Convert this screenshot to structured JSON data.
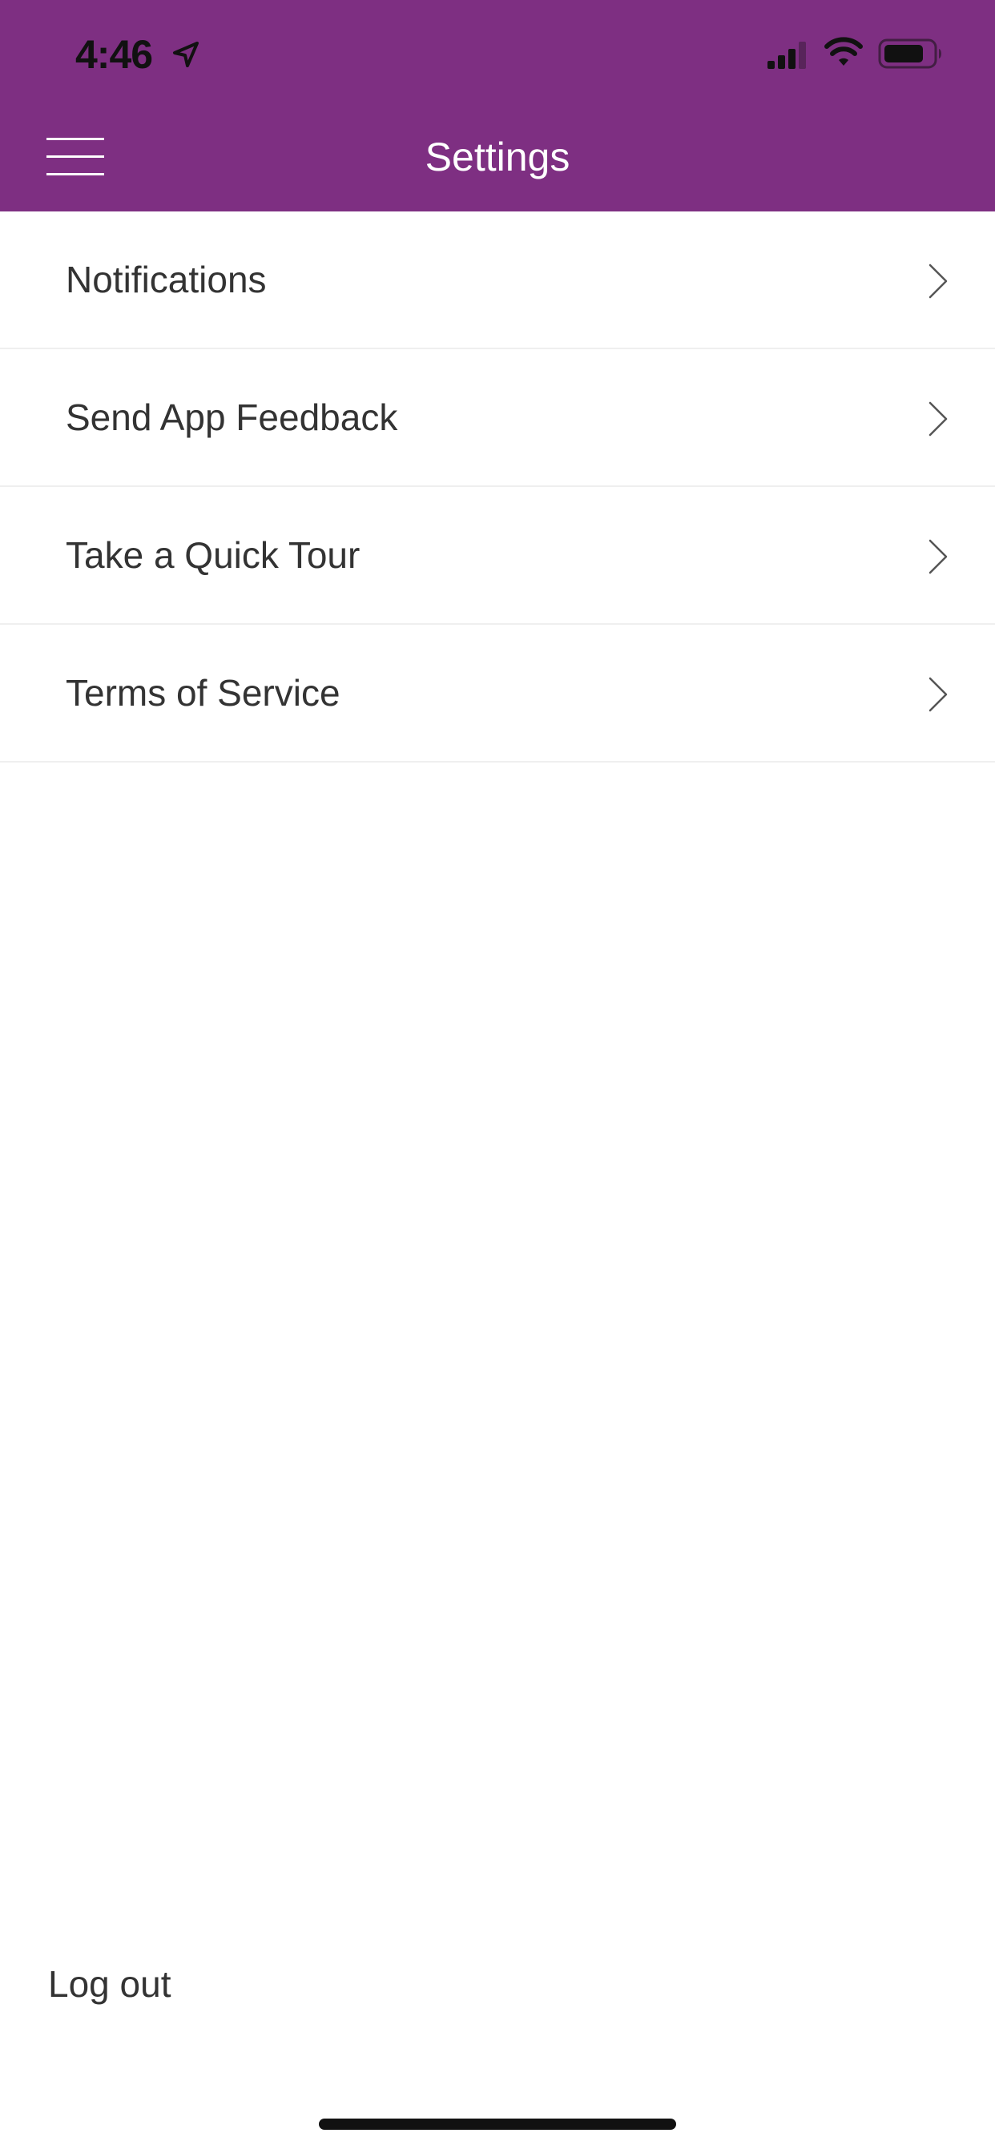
{
  "status_bar": {
    "time": "4:46",
    "icons": [
      "location-arrow-icon",
      "signal-icon",
      "wifi-icon",
      "battery-icon"
    ]
  },
  "header": {
    "title": "Settings",
    "menu_icon": "hamburger-menu-icon",
    "background_color": "#7e2f82"
  },
  "settings": {
    "items": [
      {
        "label": "Notifications"
      },
      {
        "label": "Send App Feedback"
      },
      {
        "label": "Take a Quick Tour"
      },
      {
        "label": "Terms of Service"
      }
    ]
  },
  "footer": {
    "logout_label": "Log out"
  }
}
